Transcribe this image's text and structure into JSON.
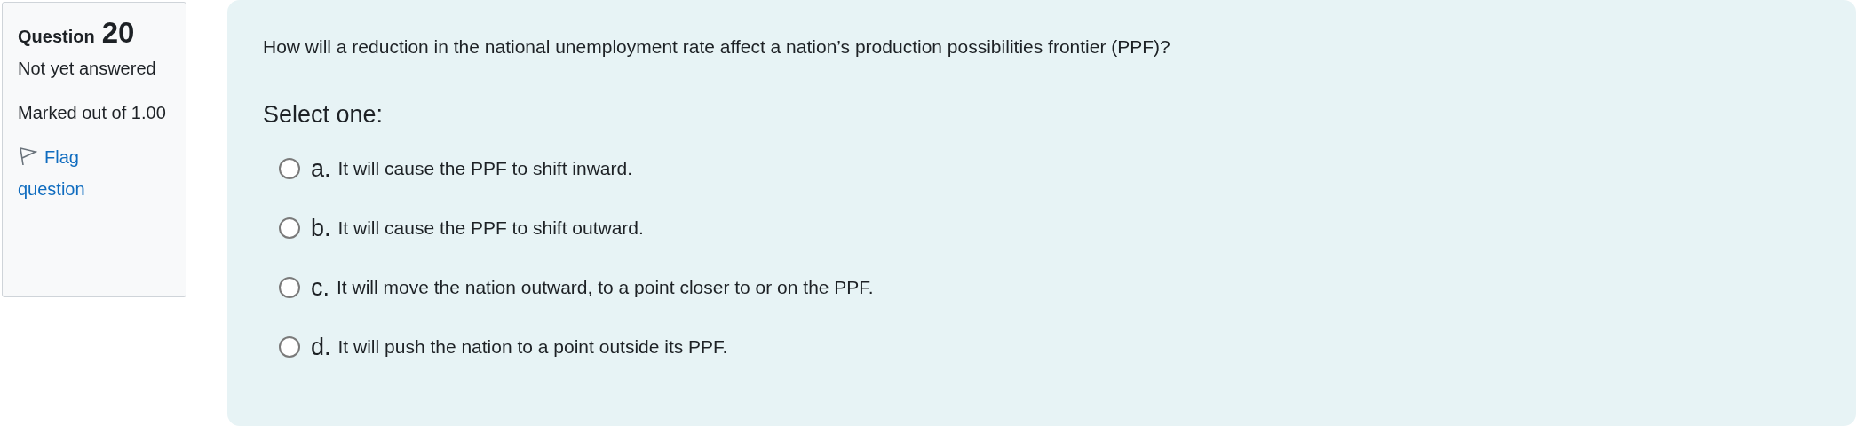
{
  "info": {
    "label": "Question",
    "number": "20",
    "status": "Not yet answered",
    "marks": "Marked out of 1.00",
    "flag": {
      "label": "Flag question",
      "flagged": false
    }
  },
  "question": {
    "text": "How will a reduction in the national unemployment rate affect a nation’s production possibilities frontier (PPF)?",
    "prompt": "Select one:",
    "options": [
      {
        "letter": "a.",
        "text": "It will cause the PPF to shift inward.",
        "selected": false
      },
      {
        "letter": "b.",
        "text": "It will cause the PPF to shift outward.",
        "selected": false
      },
      {
        "letter": "c.",
        "text": "It will move the nation outward, to a point closer to or on the PPF.",
        "selected": false
      },
      {
        "letter": "d.",
        "text": "It will push the nation to a point outside its PPF.",
        "selected": false
      }
    ]
  }
}
